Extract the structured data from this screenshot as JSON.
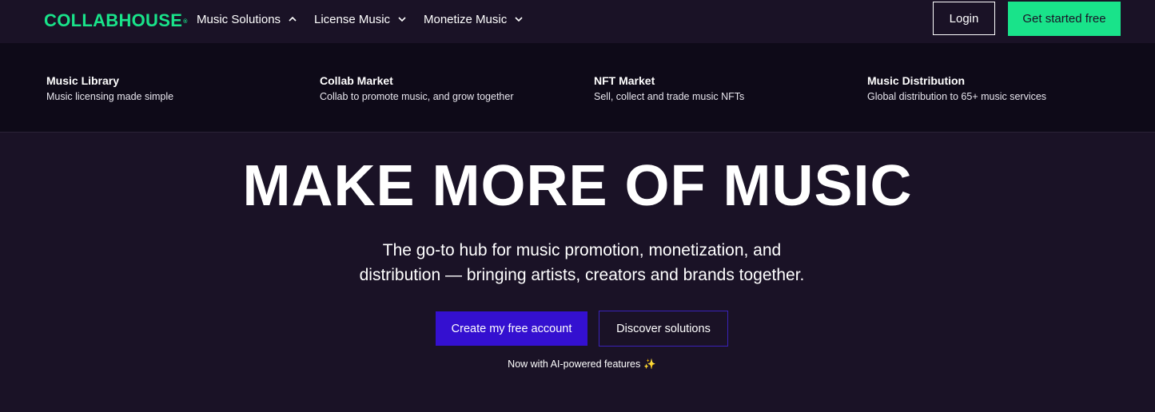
{
  "header": {
    "logo_text": "COLLABHOUSE",
    "logo_mark": "®",
    "brand_color": "#19e38a",
    "nav": [
      {
        "label": "Music Solutions",
        "icon": "chevron-up-icon"
      },
      {
        "label": "License Music",
        "icon": "chevron-down-icon"
      },
      {
        "label": "Monetize Music",
        "icon": "chevron-down-icon"
      }
    ],
    "login_label": "Login",
    "get_started_label": "Get started free"
  },
  "dropdown": {
    "items": [
      {
        "title": "Music Library",
        "subtitle": "Music licensing made simple"
      },
      {
        "title": "Collab Market",
        "subtitle": "Collab to promote music, and grow together"
      },
      {
        "title": "NFT Market",
        "subtitle": "Sell, collect and trade music NFTs"
      },
      {
        "title": "Music Distribution",
        "subtitle": "Global distribution to 65+ music services"
      }
    ]
  },
  "hero": {
    "title": "MAKE MORE OF MUSIC",
    "subtitle_line1": "The go-to hub for music promotion, monetization, and",
    "subtitle_line2": "distribution — bringing artists, creators and brands together.",
    "primary_button": "Create my free account",
    "secondary_button": "Discover solutions",
    "note": "Now with AI-powered features",
    "note_icon": "sparkle-icon",
    "accent_color": "#3410d0"
  }
}
